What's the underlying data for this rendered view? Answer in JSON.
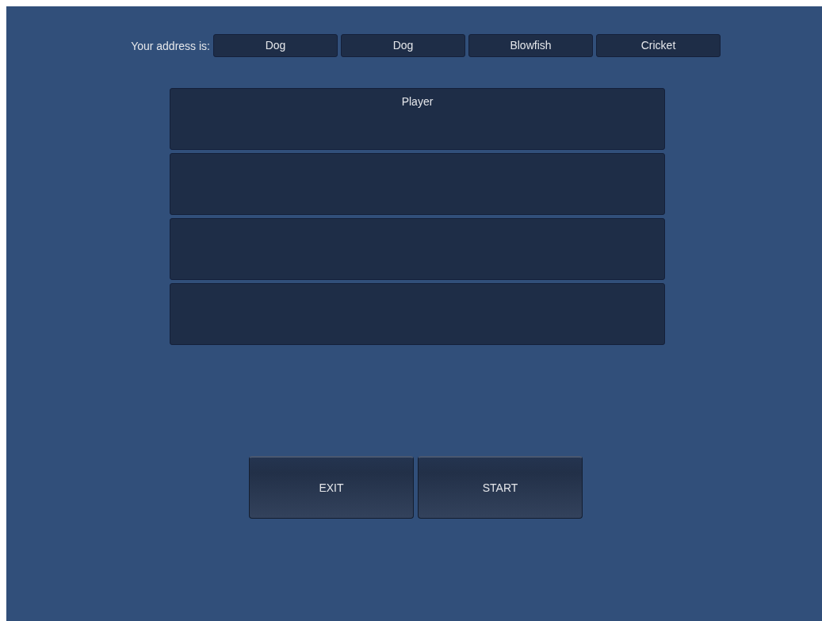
{
  "address": {
    "label": "Your address is:",
    "words": [
      "Dog",
      "Dog",
      "Blowfish",
      "Cricket"
    ]
  },
  "player_slots": [
    {
      "kind": "named",
      "label": "Player"
    },
    {
      "kind": "empty"
    },
    {
      "kind": "empty"
    },
    {
      "kind": "empty"
    }
  ],
  "buttons": [
    {
      "label": "EXIT"
    },
    {
      "label": "START"
    }
  ]
}
